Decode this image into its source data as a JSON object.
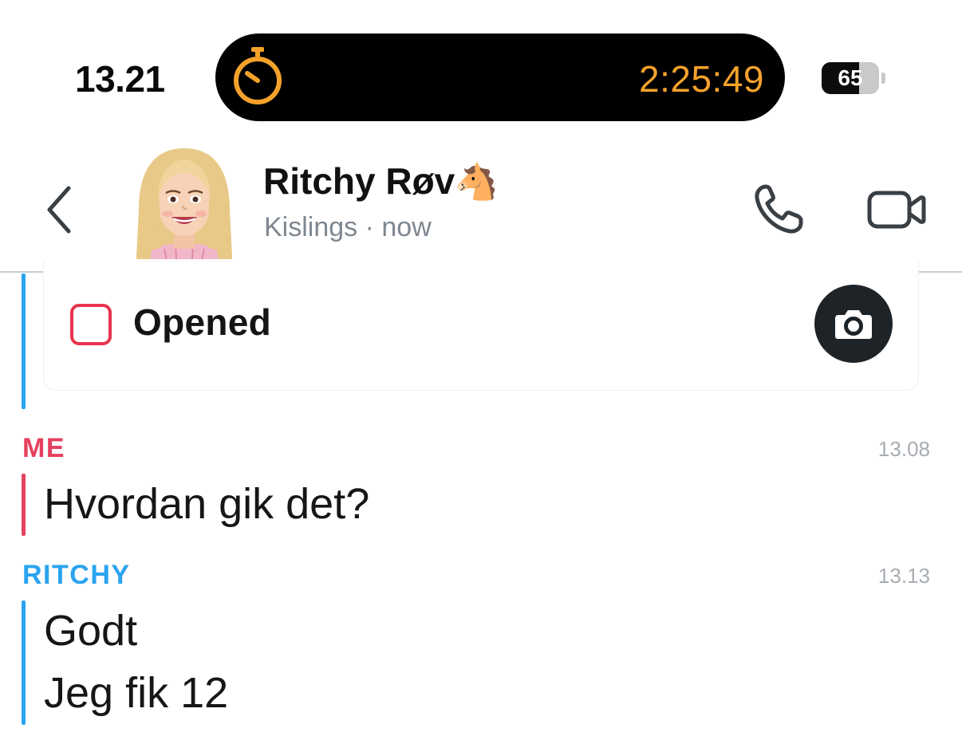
{
  "status_bar": {
    "time": "13.21",
    "stopwatch": "2:25:49",
    "battery_percent": "65",
    "battery_level": 0.65,
    "timer_icon": "stopwatch-icon"
  },
  "header": {
    "contact_name": "Ritchy Røv",
    "name_emoji": "🐴",
    "subtitle": "Kislings · now",
    "back_icon": "chevron-left-icon",
    "call_icon": "phone-icon",
    "video_icon": "video-camera-icon"
  },
  "snap": {
    "status_label": "Opened",
    "camera_icon": "camera-icon"
  },
  "messages": [
    {
      "sender": "ME",
      "time": "13.08",
      "lines": [
        "Hvordan gik det?"
      ]
    },
    {
      "sender": "RITCHY",
      "time": "13.13",
      "lines": [
        "Godt",
        "Jeg fik 12"
      ]
    }
  ],
  "colors": {
    "me_accent": "#e5405e",
    "friend_accent": "#2ba3f0",
    "timer_orange": "#f5a22b",
    "snap_unopened_red": "#e8344e"
  }
}
